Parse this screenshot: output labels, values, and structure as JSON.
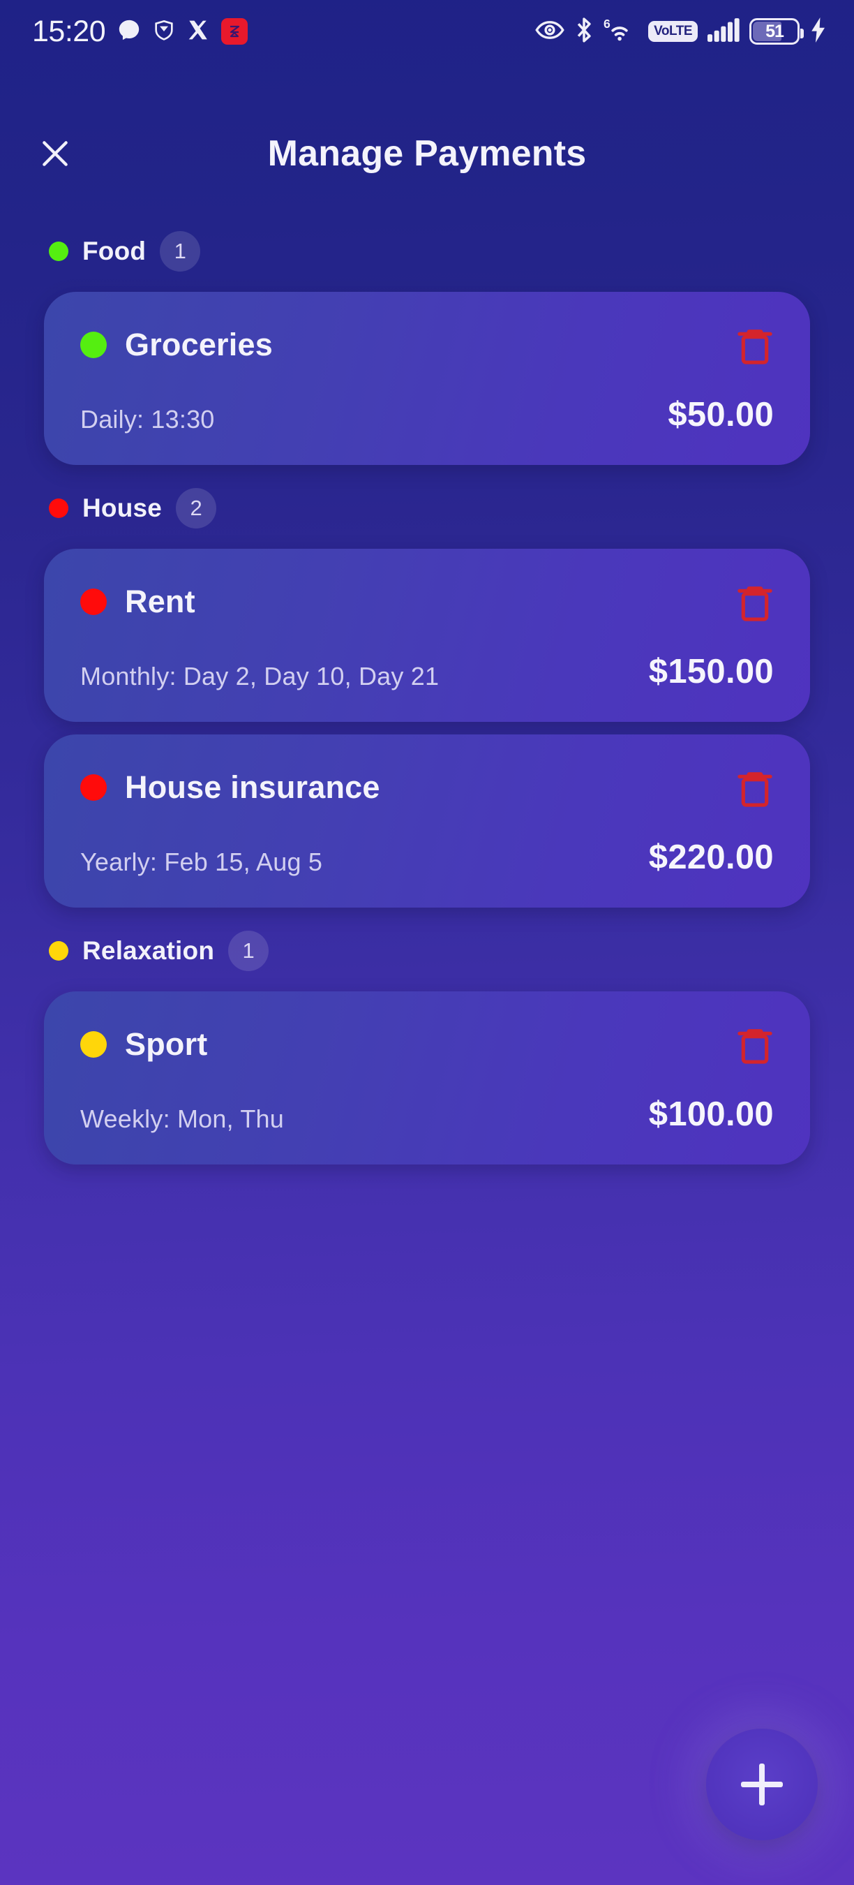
{
  "status_bar": {
    "clock": "15:20",
    "left_icons": [
      "messenger-icon",
      "shield-icon",
      "x-twitter-icon",
      "z-app-icon"
    ],
    "right_icons": [
      "eye-icon",
      "bluetooth-icon",
      "wifi-6-icon",
      "volte-icon",
      "cellular-signal-icon",
      "battery-icon"
    ],
    "wifi_generation": "6",
    "volte_label": "VoLTE",
    "battery_level": "51",
    "battery_charging": true
  },
  "header": {
    "title": "Manage Payments",
    "close_label": "✕"
  },
  "colors": {
    "food_dot": "#55ee11",
    "house_dot": "#ff0b0b",
    "relaxation_dot": "#ffd60a",
    "delete_icon": "#d4242c",
    "card_gradient_start": "#3c46ab",
    "card_gradient_end": "#4f33bf",
    "background_start": "#1f2287",
    "background_end": "#5c34c0"
  },
  "sections": [
    {
      "name": "Food",
      "count": "1",
      "dot_color": "#55ee11",
      "payments": [
        {
          "title": "Groceries",
          "dot_color": "#55ee11",
          "schedule": "Daily: 13:30",
          "amount": "$50.00",
          "delete_label": "Delete"
        }
      ]
    },
    {
      "name": "House",
      "count": "2",
      "dot_color": "#ff0b0b",
      "payments": [
        {
          "title": "Rent",
          "dot_color": "#ff0b0b",
          "schedule": "Monthly: Day 2, Day 10, Day 21",
          "amount": "$150.00",
          "delete_label": "Delete"
        },
        {
          "title": "House insurance",
          "dot_color": "#ff0b0b",
          "schedule": "Yearly: Feb 15, Aug 5",
          "amount": "$220.00",
          "delete_label": "Delete"
        }
      ]
    },
    {
      "name": "Relaxation",
      "count": "1",
      "dot_color": "#ffd60a",
      "payments": [
        {
          "title": "Sport",
          "dot_color": "#ffd60a",
          "schedule": "Weekly: Mon, Thu",
          "amount": "$100.00",
          "delete_label": "Delete"
        }
      ]
    }
  ],
  "fab": {
    "label": "+",
    "name": "add-payment"
  }
}
